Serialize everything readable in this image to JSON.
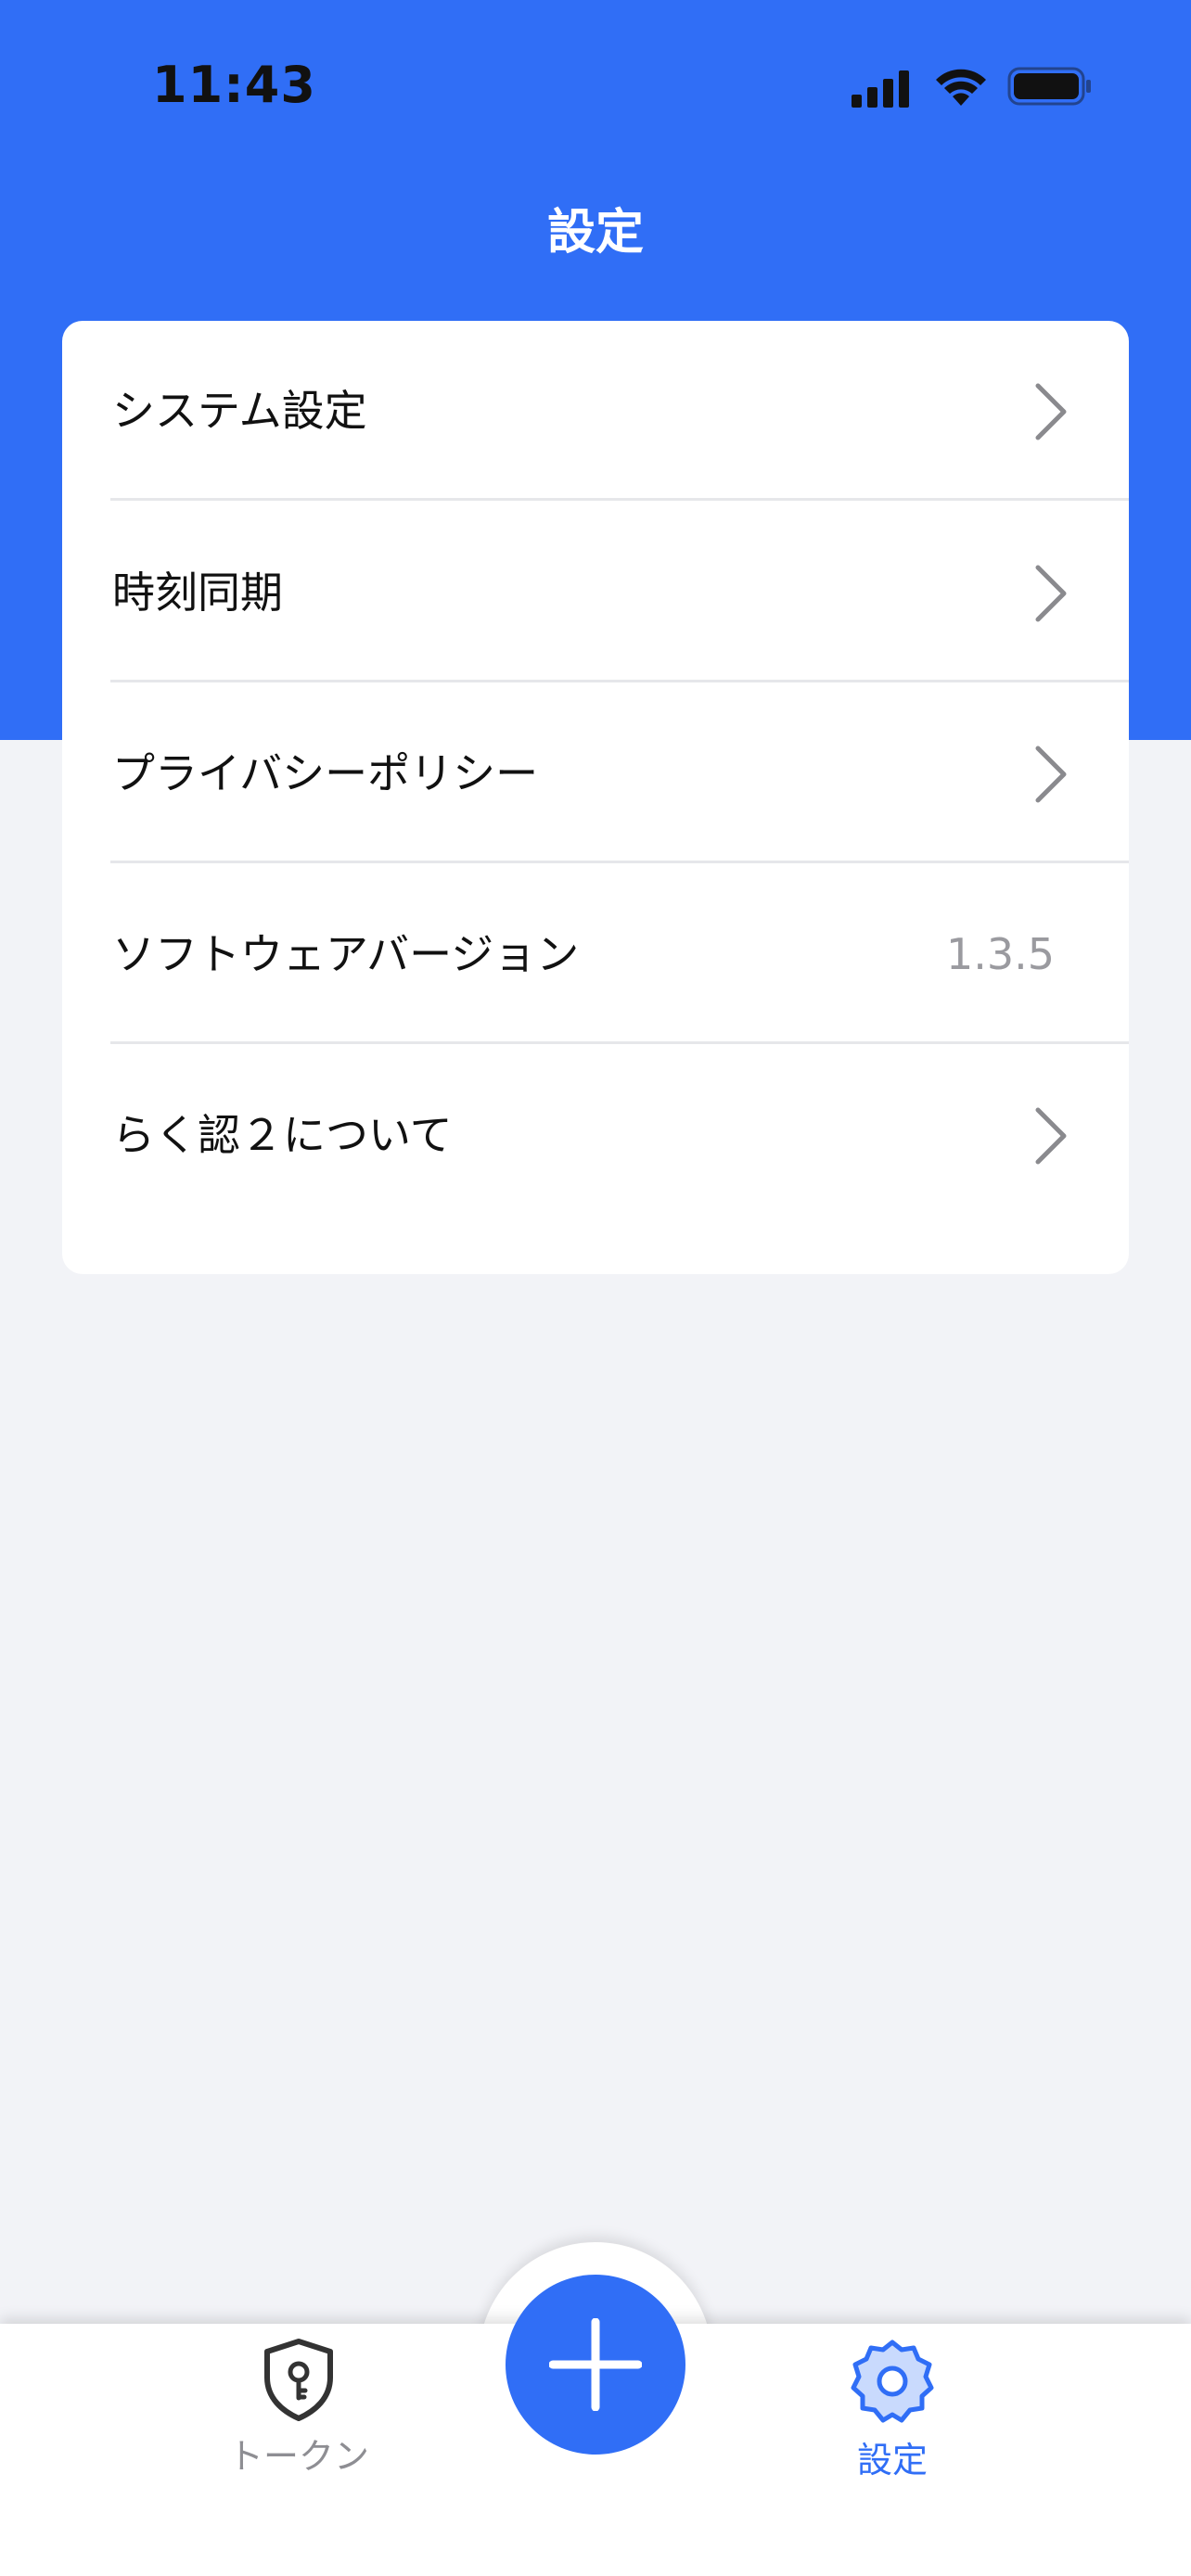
{
  "status_bar": {
    "time": "11:43"
  },
  "header": {
    "title": "設定"
  },
  "settings_list": [
    {
      "label": "システム設定",
      "value": null,
      "has_chevron": true
    },
    {
      "label": "時刻同期",
      "value": null,
      "has_chevron": true
    },
    {
      "label": "プライバシーポリシー",
      "value": null,
      "has_chevron": true
    },
    {
      "label": "ソフトウェアバージョン",
      "value": "1.3.5",
      "has_chevron": false
    },
    {
      "label": "らく認２について",
      "value": null,
      "has_chevron": true
    }
  ],
  "tab_bar": {
    "token_label": "トークン",
    "token_icon": "shield-key-icon",
    "add_icon": "plus-icon",
    "settings_label": "設定",
    "settings_icon": "gear-icon"
  },
  "colors": {
    "accent": "#306EF6",
    "background": "#F2F3F7",
    "card": "#FFFFFF",
    "inactive": "#8E8E93"
  }
}
